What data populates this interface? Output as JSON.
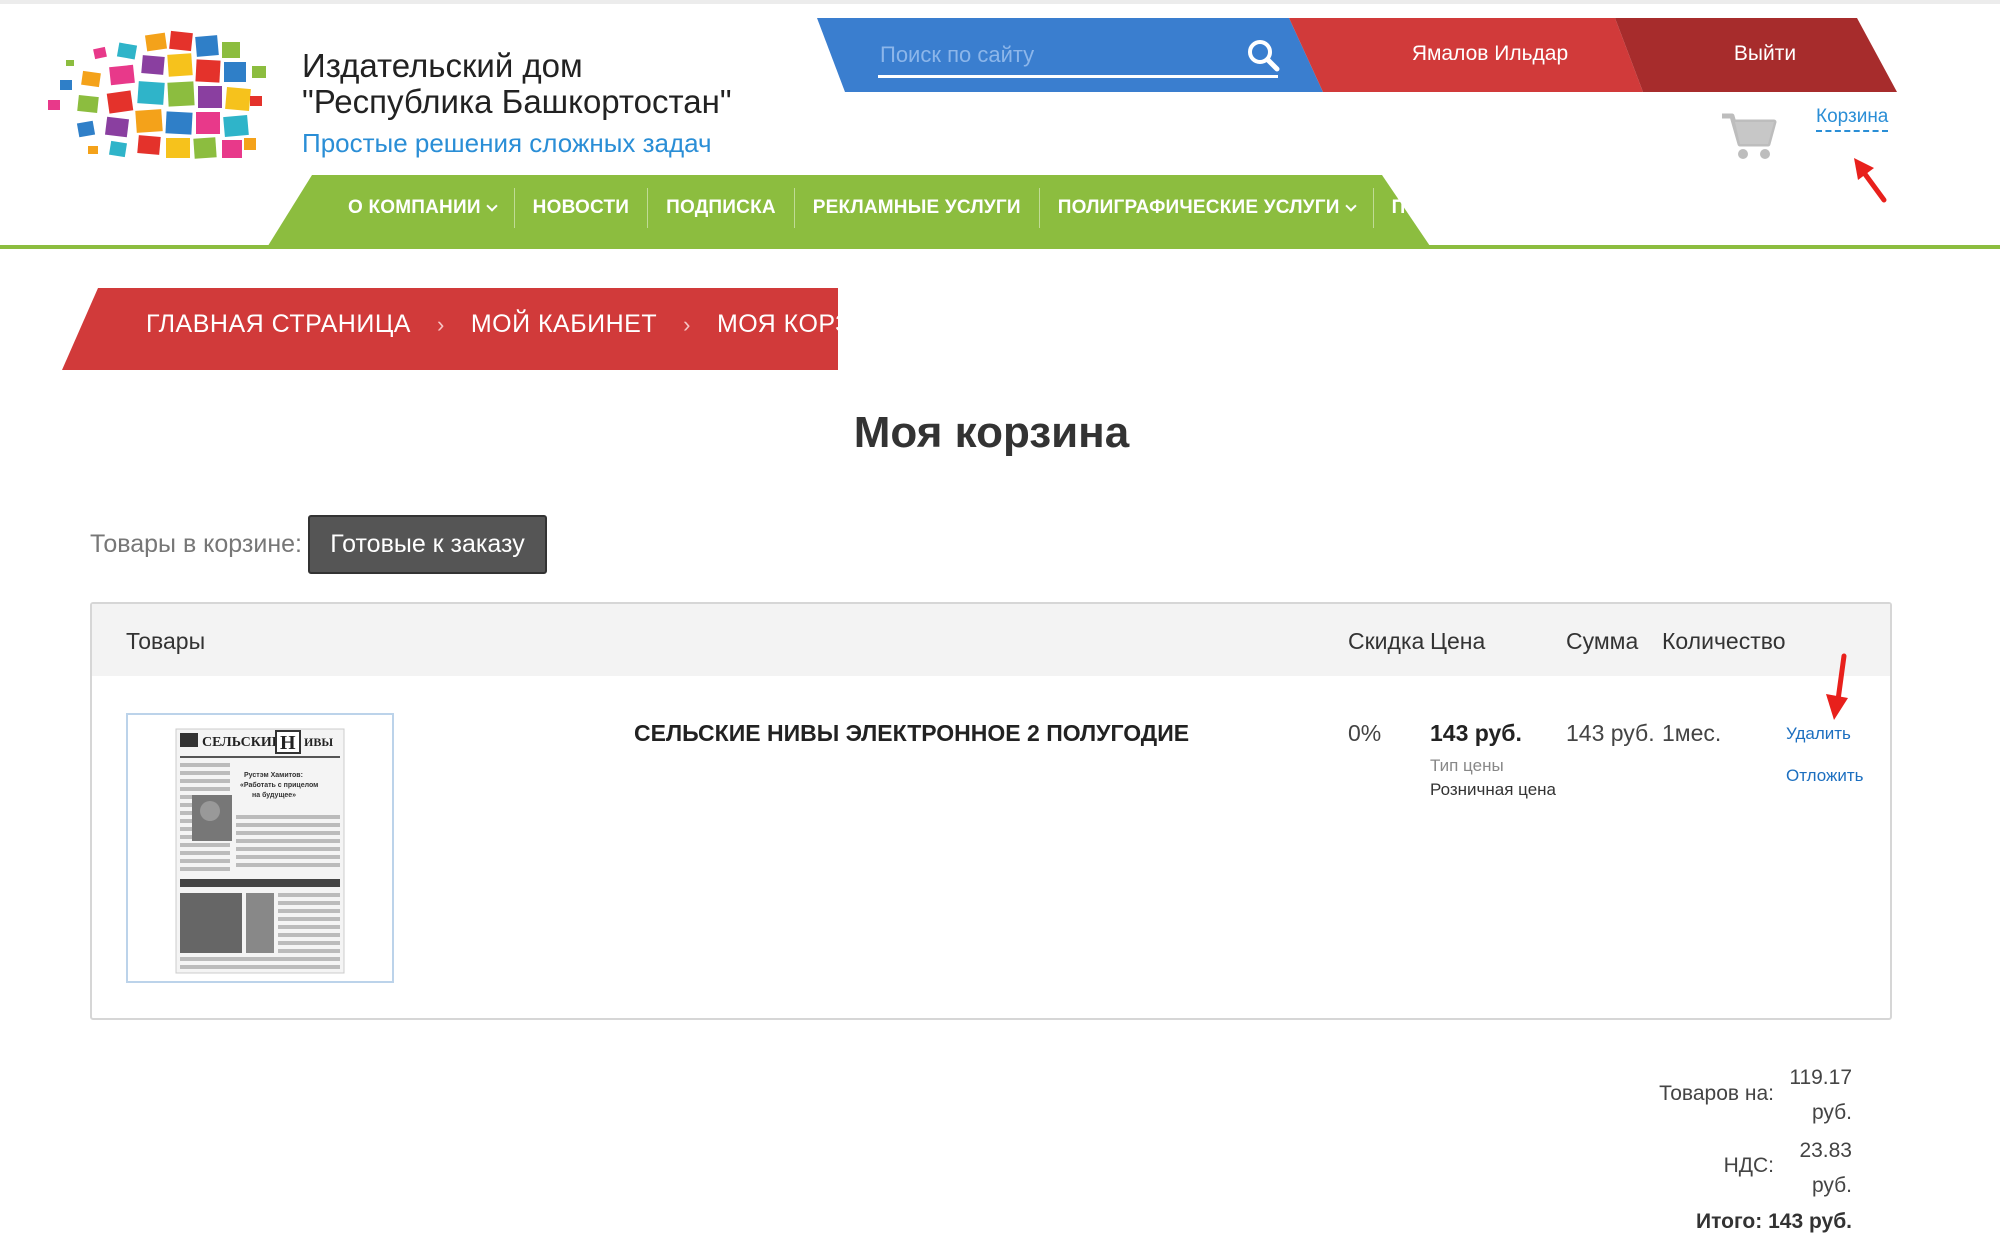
{
  "header": {
    "brand_line1": "Издательский дом",
    "brand_line2": "\"Республика Башкортостан\"",
    "tagline": "Простые решения сложных задач",
    "search_placeholder": "Поиск по сайту",
    "user_name": "Ямалов Ильдар",
    "logout_label": "Выйти",
    "cart_link": "Корзина",
    "colors": {
      "blue": "#3a7ecf",
      "red": "#d13a3a",
      "dark_red": "#a72c2c",
      "green": "#8cbd3f"
    }
  },
  "nav": {
    "items": [
      {
        "label": "О КОМПАНИИ",
        "dropdown": true
      },
      {
        "label": "НОВОСТИ",
        "dropdown": false
      },
      {
        "label": "ПОДПИСКА",
        "dropdown": false
      },
      {
        "label": "РЕКЛАМНЫЕ УСЛУГИ",
        "dropdown": false
      },
      {
        "label": "ПОЛИГРАФИЧЕСКИЕ УСЛУГИ",
        "dropdown": true
      },
      {
        "label": "ПОМОЩЬ",
        "dropdown": true
      }
    ]
  },
  "breadcrumb": {
    "items": [
      "ГЛАВНАЯ СТРАНИЦА",
      "МОЙ КАБИНЕТ",
      "МОЯ КОРЗИНА"
    ],
    "separator": "›"
  },
  "page_title": "Моя корзина",
  "filter": {
    "label": "Товары в корзине:",
    "button": "Готовые к заказу"
  },
  "table": {
    "headers": {
      "items": "Товары",
      "discount": "Скидка",
      "price": "Цена",
      "sum": "Сумма",
      "quantity": "Количество"
    },
    "rows": [
      {
        "name": "СЕЛЬСКИЕ НИВЫ ЭЛЕКТРОННОЕ 2 ПОЛУГОДИЕ",
        "discount": "0%",
        "price": "143 руб.",
        "price_type_label": "Тип цены",
        "price_type": "Розничная цена",
        "sum": "143 руб.",
        "quantity": "1мес.",
        "delete_label": "Удалить",
        "postpone_label": "Отложить"
      }
    ]
  },
  "totals": {
    "goods_label": "Товаров на:",
    "goods_value": "119.17",
    "goods_unit": "руб.",
    "vat_label": "НДС:",
    "vat_value": "23.83",
    "vat_unit": "руб.",
    "total": "Итого: 143 руб."
  }
}
